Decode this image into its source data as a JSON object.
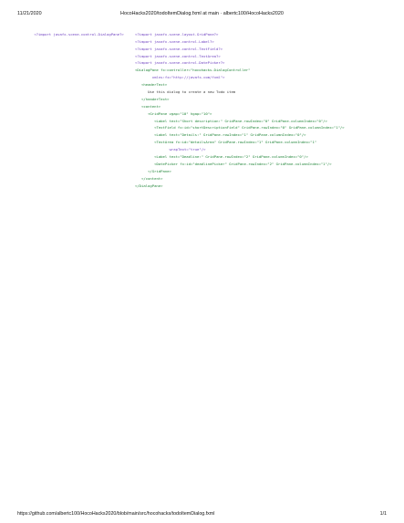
{
  "header": {
    "date": "11/21/2020",
    "title": "HocoHacks2020/todoItemDialog.fxml at main · albertc100/HocoHacks2020"
  },
  "footer": {
    "url": "https://github.com/albertc100/HocoHacks2020/blob/main/src/hocohacks/todoItemDialog.fxml",
    "page": "1/1"
  },
  "code": {
    "first_line": "<?import javafx.scene.control.DialogPane?>",
    "lines": [
      {
        "indent": 0,
        "text": "<?import javafx.scene.layout.GridPane?>"
      },
      {
        "indent": 0,
        "text": "<?import javafx.scene.control.Label?>"
      },
      {
        "indent": 0,
        "text": "<?import javafx.scene.control.TextField?>"
      },
      {
        "indent": 0,
        "text": "<?import javafx.scene.control.TextArea?>"
      },
      {
        "indent": 0,
        "text": "<?import javafx.scene.control.DatePicker?>"
      },
      {
        "indent": 0,
        "text": "<DialogPane fx:controller=\"hocohacks.DialogController\""
      },
      {
        "indent": 8,
        "text": "xmlns:fx=\"http://javafx.com/fxml\">"
      },
      {
        "indent": 3,
        "text": "<headerText>"
      },
      {
        "indent": 6,
        "text": "Use this dialog to create a new Todo item"
      },
      {
        "indent": 3,
        "text": "</headerText>"
      },
      {
        "indent": 3,
        "text": "<content>"
      },
      {
        "indent": 6,
        "text": "<GridPane vgap=\"10\" hgap=\"10\">"
      },
      {
        "indent": 9,
        "text": "<Label text=\"Short description:\" GridPane.rowIndex=\"0\" GridPane.columnIndex=\"0\"/>"
      },
      {
        "indent": 9,
        "text": "<TextField fx:id=\"shortDescriptionField\" GridPane.rowIndex=\"0\" GridPane.columnIndex=\"1\"/>"
      },
      {
        "indent": 9,
        "text": "<Label text=\"Details:\" GridPane.rowIndex=\"1\" GridPane.columnIndex=\"0\"/>"
      },
      {
        "indent": 9,
        "text": "<TextArea fx:id=\"detailsArea\" GridPane.rowIndex=\"1\" GridPane.columnIndex=\"1\""
      },
      {
        "indent": 16,
        "text": "wrapText=\"true\"/>"
      },
      {
        "indent": 9,
        "text": "<Label text=\"Deadline:\" GridPane.rowIndex=\"2\" GridPane.columnIndex=\"0\"/>"
      },
      {
        "indent": 9,
        "text": "<DatePicker fx:id=\"deadlinePicker\" GridPane.rowIndex=\"2\" GridPane.columnIndex=\"1\"/>"
      },
      {
        "indent": 6,
        "text": "</GridPane>"
      },
      {
        "indent": 3,
        "text": "</content>"
      },
      {
        "indent": 0,
        "text": "</DialogPane>"
      }
    ]
  }
}
